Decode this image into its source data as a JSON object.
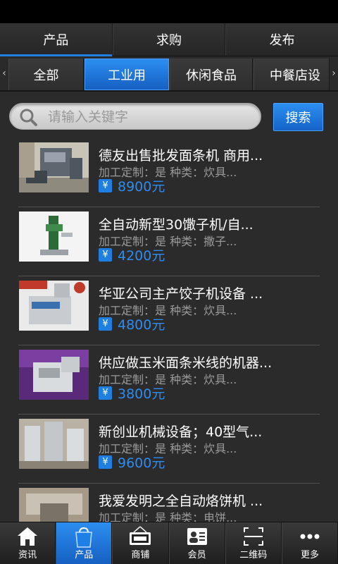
{
  "top_tabs": [
    {
      "label": "产品"
    },
    {
      "label": "求购"
    },
    {
      "label": "发布"
    }
  ],
  "categories": [
    {
      "label": "全部"
    },
    {
      "label": "工业用"
    },
    {
      "label": "休闲食品"
    },
    {
      "label": "中餐店设"
    }
  ],
  "search": {
    "placeholder": "请输入关键字",
    "button_label": "搜索"
  },
  "currency_symbol": "¥",
  "products": [
    {
      "title": "德友出售批发面条机 商用...",
      "meta": "加工定制：是  种类：炊具...",
      "price": "8900元"
    },
    {
      "title": "全自动新型30馓子机/自...",
      "meta": "加工定制：是  种类：撒子...",
      "price": "4200元"
    },
    {
      "title": "华亚公司主产饺子机设备 ...",
      "meta": "加工定制：是  种类：炊具...",
      "price": "4800元"
    },
    {
      "title": "供应做玉米面条米线的机器...",
      "meta": "加工定制：是  种类：炊具...",
      "price": "3800元"
    },
    {
      "title": "新创业机械设备；40型气...",
      "meta": "加工定制：是  种类：炊具...",
      "price": "9600元"
    },
    {
      "title": "我爱发明之全自动烙饼机 ...",
      "meta": "加工定制：是  种类：电饼...",
      "price": ""
    }
  ],
  "bottom_nav": [
    {
      "label": "资讯",
      "icon": "home-icon"
    },
    {
      "label": "产品",
      "icon": "shopping-bag-icon"
    },
    {
      "label": "商铺",
      "icon": "open-sign-icon"
    },
    {
      "label": "会员",
      "icon": "member-card-icon"
    },
    {
      "label": "二维码",
      "icon": "qr-scan-icon"
    },
    {
      "label": "更多",
      "icon": "more-dots-icon"
    }
  ],
  "colors": {
    "accent": "#1f7fe0",
    "price": "#2e8cf0",
    "background": "#2b2b2b"
  }
}
